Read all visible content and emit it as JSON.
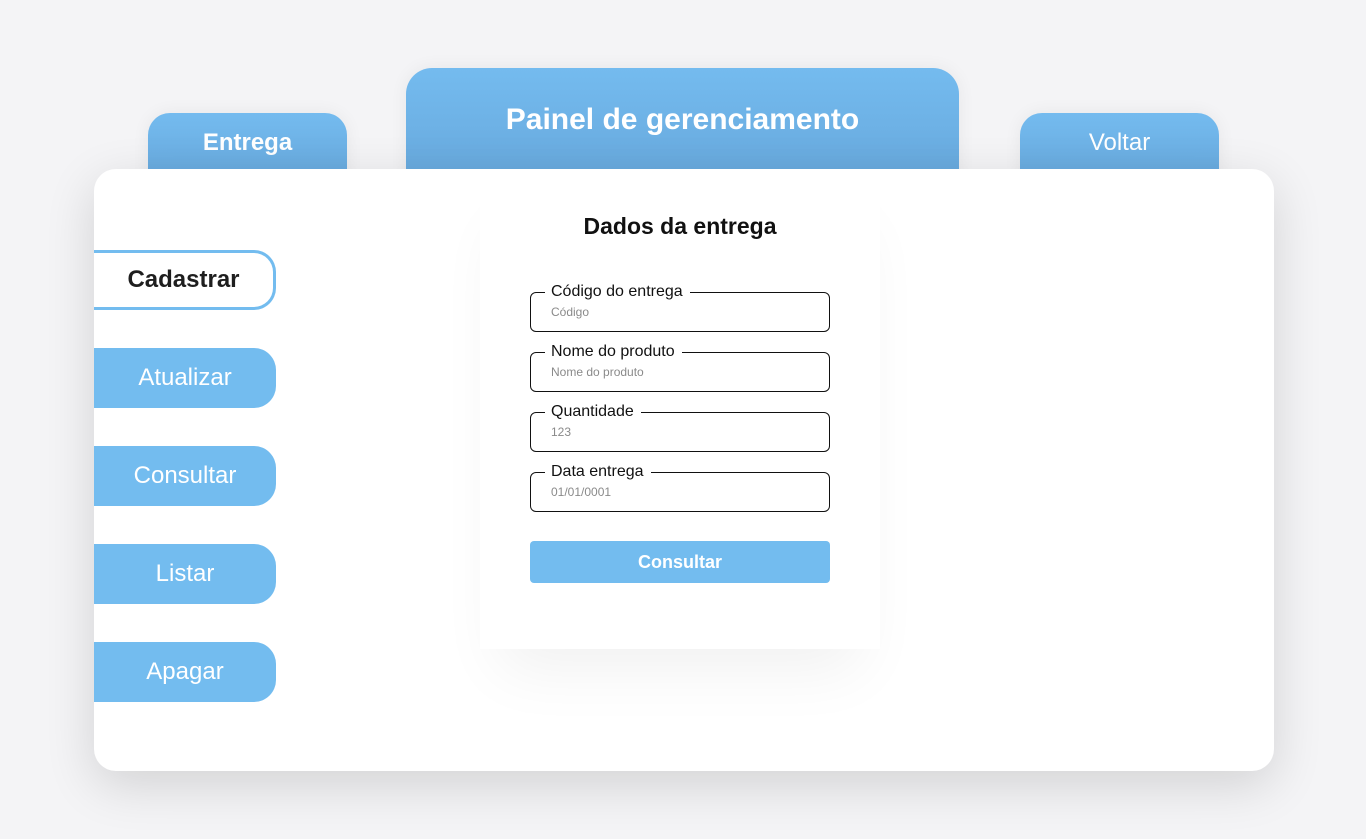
{
  "header": {
    "tab_entrega": "Entrega",
    "title": "Painel de gerenciamento",
    "tab_voltar": "Voltar"
  },
  "sidebar": {
    "items": [
      {
        "label": "Cadastrar",
        "active": true
      },
      {
        "label": "Atualizar",
        "active": false
      },
      {
        "label": "Consultar",
        "active": false
      },
      {
        "label": "Listar",
        "active": false
      },
      {
        "label": "Apagar",
        "active": false
      }
    ]
  },
  "form": {
    "title": "Dados da entrega",
    "fields": [
      {
        "label": "Código do entrega",
        "placeholder": "Código",
        "value": ""
      },
      {
        "label": "Nome do produto",
        "placeholder": "Nome do produto",
        "value": ""
      },
      {
        "label": "Quantidade",
        "placeholder": "123",
        "value": ""
      },
      {
        "label": "Data entrega",
        "placeholder": "01/01/0001",
        "value": ""
      }
    ],
    "submit_label": "Consultar"
  },
  "colors": {
    "accent": "#73bcef",
    "background": "#f4f4f6",
    "panel": "#ffffff",
    "text": "#111111"
  }
}
